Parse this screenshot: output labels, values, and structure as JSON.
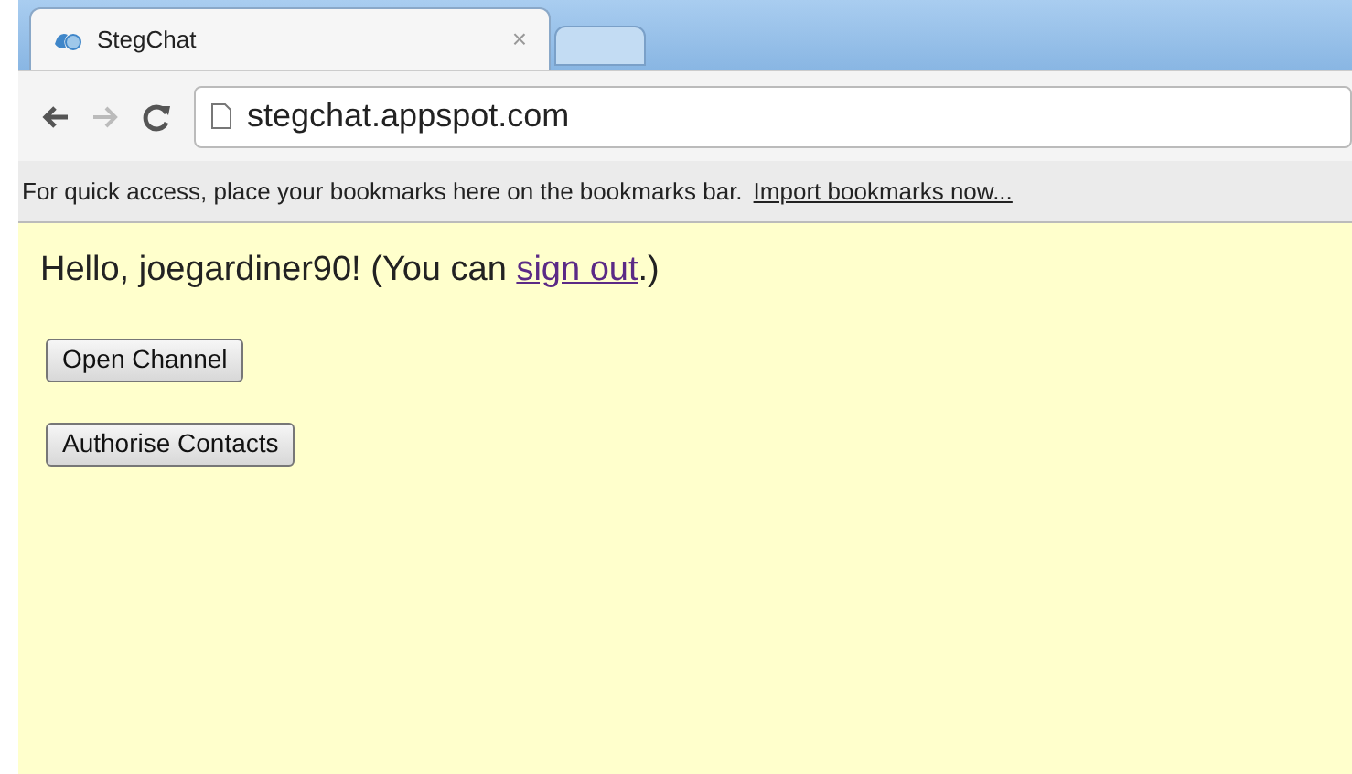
{
  "tabs": [
    {
      "title": "StegChat",
      "close": "×",
      "selected": true
    },
    {
      "selected": false
    }
  ],
  "address_bar": {
    "url": "stegchat.appspot.com"
  },
  "bookmarks_bar": {
    "message": "For quick access, place your bookmarks here on the bookmarks bar.",
    "link": "Import bookmarks now..."
  },
  "greeting": {
    "before": "Hello, joegardiner90! (You can ",
    "link": "sign out",
    "after": ".)"
  },
  "buttons": [
    "Open Channel",
    "Authorise Contacts"
  ]
}
